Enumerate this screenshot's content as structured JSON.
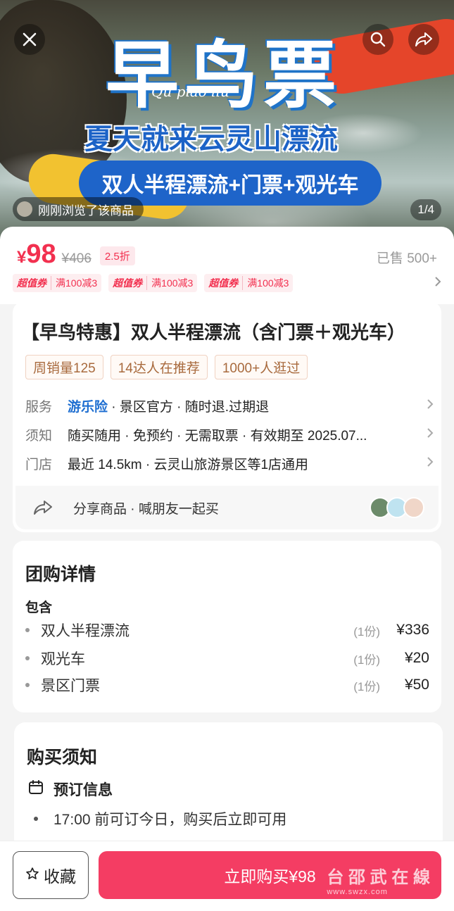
{
  "hero": {
    "title_main": "早鸟票",
    "title_en": "Qu piao liu",
    "title_sub": "夏天就来云灵山漂流",
    "title_pill": "双人半程漂流+门票+观光车",
    "viewed_text": "刚刚浏览了该商品",
    "pager": "1/4"
  },
  "price": {
    "symbol": "¥",
    "value": "98",
    "original": "¥406",
    "discount": "2.5折",
    "sold": "已售 500+"
  },
  "coupons": [
    {
      "tag": "超值券",
      "text": "满100减3"
    },
    {
      "tag": "超值券",
      "text": "满100减3"
    },
    {
      "tag": "超值券",
      "text": "满100减3"
    }
  ],
  "product": {
    "title": "【早鸟特惠】双人半程漂流（含门票＋观光车）",
    "tags": [
      "周销量125",
      "14达人在推荐",
      "1000+人逛过"
    ],
    "service": {
      "label": "服务",
      "highlight": "游乐险",
      "rest": " · 景区官方 · 随时退.过期退"
    },
    "notice": {
      "label": "须知",
      "value": "随买随用 · 免预约 · 无需取票 · 有效期至 2025.07..."
    },
    "store": {
      "label": "门店",
      "value": "最近 14.5km · 云灵山旅游景区等1店通用"
    },
    "share": "分享商品 · 喊朋友一起买"
  },
  "group": {
    "title": "团购详情",
    "include_label": "包含",
    "items": [
      {
        "name": "双人半程漂流",
        "qty": "(1份)",
        "price": "¥336"
      },
      {
        "name": "观光车",
        "qty": "(1份)",
        "price": "¥20"
      },
      {
        "name": "景区门票",
        "qty": "(1份)",
        "price": "¥50"
      }
    ]
  },
  "purchase_notice": {
    "title": "购买须知",
    "booking_title": "预订信息",
    "booking_item": "17:00 前可订今日，购买后立即可用"
  },
  "bottom": {
    "fav_label": "收藏",
    "buy_label": "立即购买¥98"
  },
  "watermark": {
    "main": "台 邵 武 在 線",
    "sub": "www.swzx.com"
  },
  "colors": {
    "accent": "#f43d63",
    "price": "#f2304f",
    "link": "#1f6fd1"
  },
  "icons": [
    "close-icon",
    "search-icon",
    "share-icon",
    "chevron-right-icon",
    "calendar-icon",
    "star-icon"
  ]
}
